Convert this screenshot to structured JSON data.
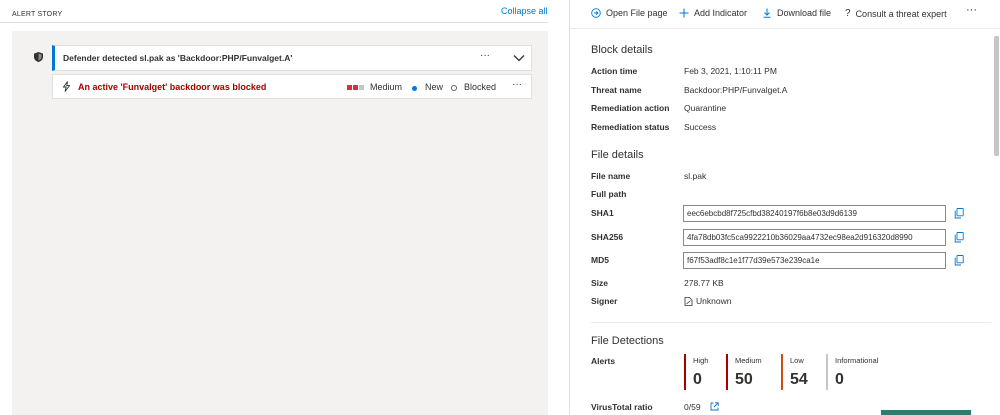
{
  "alert_story": {
    "title": "ALERT STORY",
    "collapse_all": "Collapse all",
    "detection_card": {
      "title": "Defender detected sl.pak as 'Backdoor:PHP/Funvalget.A'",
      "more": "···"
    },
    "alert_card": {
      "title": "An active 'Funvalget' backdoor was blocked",
      "severity": "Medium",
      "status": "New",
      "classification": "Blocked",
      "more": "···",
      "severity_colors": [
        "#d13438",
        "#d13438",
        "#c8c6c4"
      ]
    }
  },
  "command_bar": {
    "open_file_page": "Open File page",
    "add_indicator": "Add Indicator",
    "download_file": "Download file",
    "consult_expert": "Consult a threat expert",
    "more": "···"
  },
  "block_details": {
    "title": "Block details",
    "rows": [
      {
        "label": "Action time",
        "value": "Feb 3, 2021, 1:10:11 PM"
      },
      {
        "label": "Threat name",
        "value": "Backdoor:PHP/Funvalget.A"
      },
      {
        "label": "Remediation action",
        "value": "Quarantine"
      },
      {
        "label": "Remediation status",
        "value": "Success"
      }
    ]
  },
  "file_details": {
    "title": "File details",
    "file_name_label": "File name",
    "file_name": "sl.pak",
    "full_path_label": "Full path",
    "sha1_label": "SHA1",
    "sha1": "eec6ebcbd8f725cfbd38240197f6b8e03d9d6139",
    "sha256_label": "SHA256",
    "sha256": "4fa78db03fc5ca9922210b36029aa4732ec98ea2d916320d8990",
    "md5_label": "MD5",
    "md5": "f67f53adf8c1e1f77d39e573e239ca1e",
    "size_label": "Size",
    "size": "278.77 KB",
    "signer_label": "Signer",
    "signer": "Unknown"
  },
  "file_detections": {
    "title": "File Detections",
    "alerts_label": "Alerts",
    "alerts": [
      {
        "label": "High",
        "count": "0",
        "color": "#a80000"
      },
      {
        "label": "Medium",
        "count": "50",
        "color": "#a80000"
      },
      {
        "label": "Low",
        "count": "54",
        "color": "#ca5010"
      },
      {
        "label": "Informational",
        "count": "0",
        "color": "#c8c6c4"
      }
    ],
    "virustotal_label": "VirusTotal ratio",
    "virustotal_value": "0/59"
  },
  "colors": {
    "accent": "#0078d4",
    "alert_red": "#a80000",
    "low_orange": "#ca5010"
  }
}
